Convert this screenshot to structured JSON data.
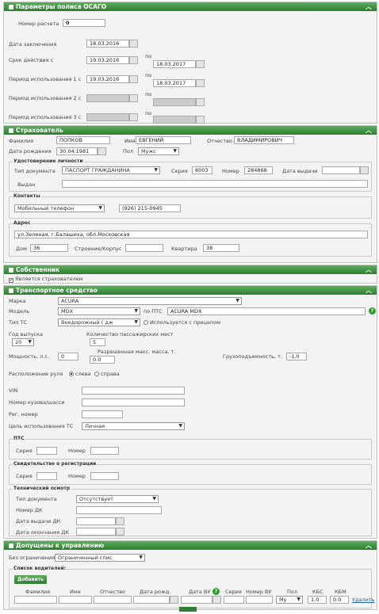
{
  "osago": {
    "title": "Параметры полиса ОСАГО",
    "calc_number_label": "Номер расчета",
    "calc_number": "0",
    "contract_date_label": "Дата заключения",
    "contract_date": "18.03.2016",
    "term_label": "Срок действия с",
    "term_from": "19.03.2016",
    "po": "по",
    "term_to": "18.03.2017",
    "use1_label": "Период использования 1 с",
    "use1_from": "19.03.2016",
    "use1_to": "18.03.2017",
    "use2_label": "Период использования 2 с",
    "use3_label": "Период использования 3 с"
  },
  "insurer": {
    "title": "Страхователь",
    "surname_label": "Фамилия",
    "surname": "ПОПКОВ",
    "name_label": "Имя",
    "name": "ЕВГЕНИЙ",
    "patronymic_label": "Отчество",
    "patronymic": "ВЛАДИМИРОВИЧ",
    "birth_label": "Дата рождения",
    "birth": "30.04.1981",
    "sex_label": "Пол",
    "sex": "Мужс",
    "id_legend": "Удостоверение личности",
    "doctype_label": "Тип документа",
    "doctype": "ПАСПОРТ ГРАЖДАНИНА",
    "series_label": "Серия",
    "series": "8003",
    "number_label": "Номер",
    "number": "284868",
    "issue_date_label": "Дата выдачи",
    "issued_label": "Выдан",
    "contacts_legend": "Контакты",
    "contact_type": "Мобильный телефон",
    "phone": "(926) 215-0945",
    "address_legend": "Адрес",
    "address": "ул.Зеленая, г.Балашиха, обл.Московская",
    "house_label": "Дом",
    "house": "36",
    "building_label": "Строение/Корпус",
    "flat_label": "Квартира",
    "flat": "38"
  },
  "owner": {
    "title": "Собственник",
    "is_insurer_label": "Является страхователем"
  },
  "vehicle": {
    "title": "Транспортное средство",
    "make_label": "Марка",
    "make": "ACURA",
    "model_label": "Модель",
    "model": "MDX",
    "pts_label": "по ПТС",
    "pts_model": "ACURA MDX",
    "type_label": "Тип ТС",
    "type": "Внедорожный ( дж",
    "trailer_label": "Используется с прицепом",
    "year_label": "Год выпуска",
    "year": "20",
    "seats_label": "Количество пассажирских мест",
    "seats": "5",
    "power_label": "Мощность, л.с.",
    "power": "0",
    "maxmass_label1": "Разрешенная макс. масса, т.",
    "maxmass": "0.0",
    "capacity_label": "Грузоподъемность, т.",
    "capacity": "-1.0",
    "wheel_label": "Расположение руля",
    "wheel_left": "слева",
    "wheel_right": "справа",
    "vin_label": "VIN",
    "body_label": "Номер кузова/шасси",
    "reg_label": "Рег. номер",
    "purpose_label": "Цель использования ТС",
    "purpose": "Личная",
    "pts_legend": "ПТС",
    "pts_series_label": "Серия",
    "pts_number_label": "Номер",
    "reg_legend": "Свидетельство о регистрации",
    "reg_series_label": "Серия",
    "reg_number_label": "Номер",
    "insp_legend": "Технический осмотр",
    "insp_doctype_label": "Тип документа",
    "insp_doctype": "Отсутствует",
    "dk_label": "Номер ДК",
    "dk_issue_label": "Дата выдачи ДК",
    "dk_end_label": "Дата окончания ДК"
  },
  "drivers": {
    "title": "Допущены к управлению",
    "no_limit_label": "Без ограничения",
    "limit_value": "Ограниченный спис",
    "list_legend": "Список водителей:",
    "add_button": "Добавить",
    "columns": [
      "Фамилия",
      "Имя",
      "Отчество",
      "Дата рожд.",
      "Дата ВУ",
      "Серия",
      "Номер ВУ",
      "Пол",
      "КБС",
      "КБМ"
    ],
    "row_sex": "Му",
    "row_kbs": "1.0",
    "row_kbm": "0.0",
    "delete_link": "Удалить"
  },
  "colors": {
    "header": "#2e7d32",
    "panel": "#f3f3f3"
  }
}
